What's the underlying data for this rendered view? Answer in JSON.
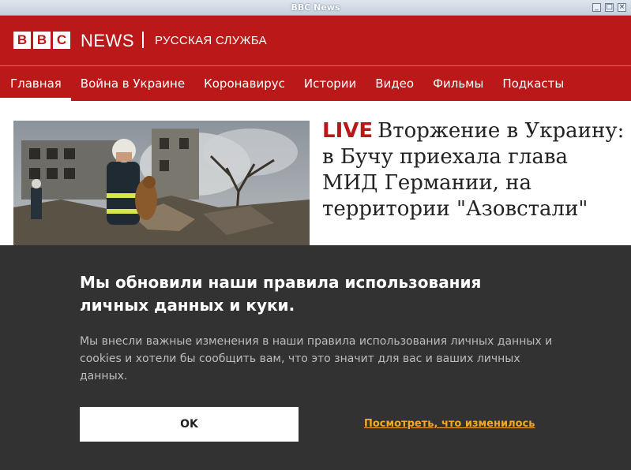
{
  "window": {
    "title": "BBC News"
  },
  "header": {
    "logo_letters": [
      "B",
      "B",
      "C"
    ],
    "news_label": "NEWS",
    "service_label": "РУССКАЯ СЛУЖБА",
    "nav": [
      {
        "label": "Главная",
        "active": true
      },
      {
        "label": "Война в Украине"
      },
      {
        "label": "Коронавирус"
      },
      {
        "label": "Истории"
      },
      {
        "label": "Видео"
      },
      {
        "label": "Фильмы"
      },
      {
        "label": "Подкасты"
      }
    ]
  },
  "article": {
    "live_badge": "LIVE",
    "headline": "Вторжение в Украину: в Бучу приехала глава МИД Германии, на территории \"Азовстали\""
  },
  "cookie_banner": {
    "title": "Мы обновили наши правила использования личных данных и куки.",
    "text": "Мы внесли важные изменения в наши правила использования личных данных и cookies и хотели бы сообщить вам, что это значит для вас и ваших личных данных.",
    "ok_label": "OK",
    "link_label": "Посмотреть, что изменилось"
  },
  "colors": {
    "brand_red": "#bb1919",
    "banner_bg": "#323232",
    "link": "#f5a623"
  }
}
